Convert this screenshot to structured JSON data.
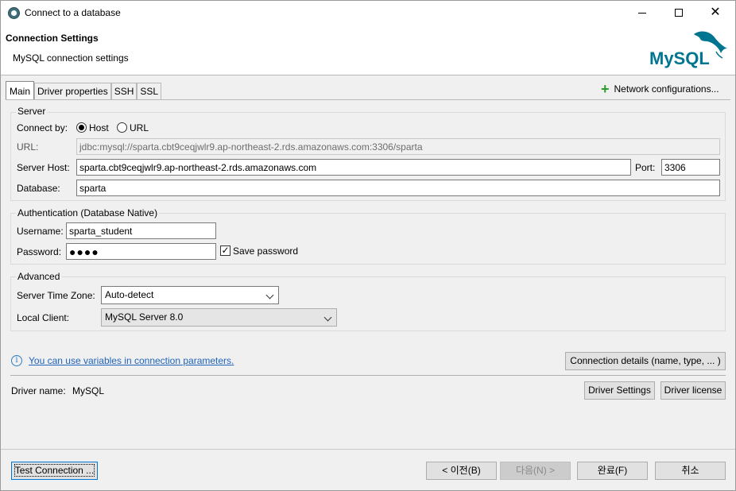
{
  "window": {
    "title": "Connect to a database"
  },
  "header": {
    "title": "Connection Settings",
    "subtitle": "MySQL connection settings",
    "logo_text": "MySQL"
  },
  "tabs": [
    {
      "label": "Main"
    },
    {
      "label": "Driver properties"
    },
    {
      "label": "SSH"
    },
    {
      "label": "SSL"
    }
  ],
  "network_config_label": "Network configurations...",
  "server": {
    "group_label": "Server",
    "connect_by_label": "Connect by:",
    "host_option": "Host",
    "url_option": "URL",
    "selected": "Host",
    "url_label": "URL:",
    "url_value": "jdbc:mysql://sparta.cbt9ceqjwlr9.ap-northeast-2.rds.amazonaws.com:3306/sparta",
    "host_label": "Server Host:",
    "host_value": "sparta.cbt9ceqjwlr9.ap-northeast-2.rds.amazonaws.com",
    "port_label": "Port:",
    "port_value": "3306",
    "db_label": "Database:",
    "db_value": "sparta"
  },
  "auth": {
    "group_label": "Authentication (Database Native)",
    "username_label": "Username:",
    "username_value": "sparta_student",
    "password_label": "Password:",
    "password_mask": "●●●●",
    "save_password_label": "Save password",
    "save_password_checked": true
  },
  "advanced": {
    "group_label": "Advanced",
    "timezone_label": "Server Time Zone:",
    "timezone_value": "Auto-detect",
    "client_label": "Local Client:",
    "client_value": "MySQL Server 8.0"
  },
  "info_link": "You can use variables in connection parameters.",
  "connection_details_button": "Connection details (name, type, ... )",
  "driver": {
    "label": "Driver name:",
    "value": "MySQL",
    "settings_button": "Driver Settings",
    "license_button": "Driver license"
  },
  "footer": {
    "test_button": "Test Connection ...",
    "back_button": "< 이전(B)",
    "next_button": "다음(N) >",
    "finish_button": "완료(F)",
    "cancel_button": "취소"
  },
  "colors": {
    "link": "#1f63b8",
    "accent": "#0078d7",
    "mysql_blue": "#00758f",
    "mysql_orange": "#f29111"
  }
}
